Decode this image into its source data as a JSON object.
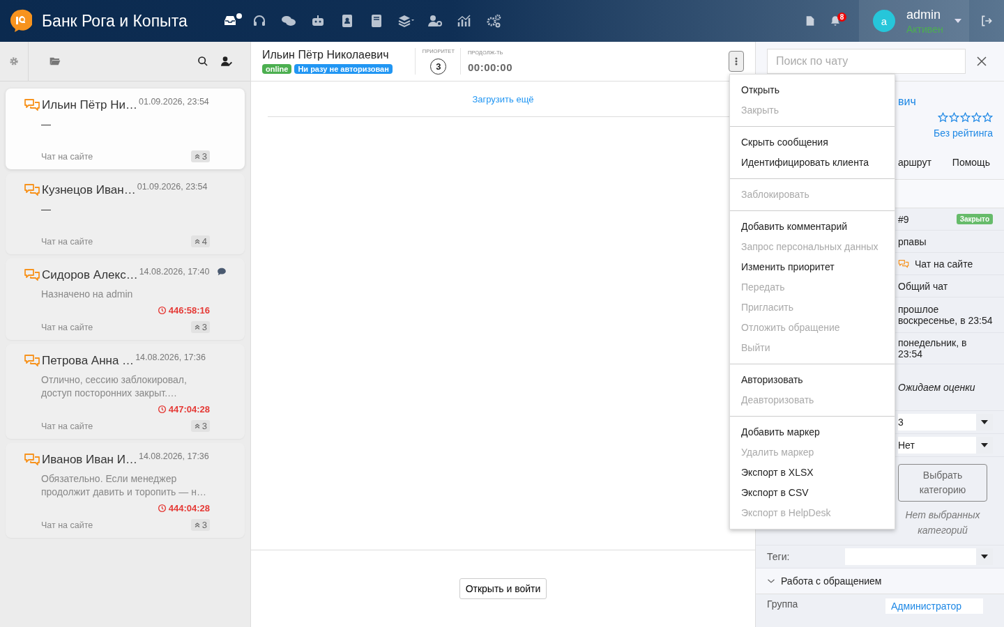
{
  "topbar": {
    "brand": "Банк Рога и Копыта",
    "nav": [
      {
        "dot": true
      },
      {
        "dot": false
      },
      {
        "dot": false
      },
      {
        "dot": false
      },
      {
        "dot": false
      },
      {
        "dot": false
      },
      {
        "dot": false
      },
      {
        "dot": false
      },
      {
        "dot": false
      },
      {
        "dot": false
      }
    ],
    "notifications": "8",
    "user": {
      "initial": "a",
      "name": "admin",
      "status": "Активен"
    }
  },
  "chat_list": [
    {
      "name": "Ильин Пётр Ни…",
      "date": "01.09.2026, 23:54",
      "preview": "—",
      "channel": "Чат на сайте",
      "priority": "3",
      "selected": true,
      "comment": false
    },
    {
      "name": "Кузнецов Иван…",
      "date": "01.09.2026, 23:54",
      "preview": "—",
      "channel": "Чат на сайте",
      "priority": "4",
      "selected": false,
      "comment": false
    },
    {
      "name": "Сидоров Алекс…",
      "date": "14.08.2026, 17:40",
      "preview": "Назначено на admin",
      "timer": "446:58:16",
      "channel": "Чат на сайте",
      "priority": "3",
      "selected": false,
      "comment": true
    },
    {
      "name": "Петрова Анна …",
      "date": "14.08.2026, 17:36",
      "preview": "Отлично, сессию заблокировал, доступ посторонних закрыт.…",
      "timer": "447:04:28",
      "channel": "Чат на сайте",
      "priority": "3",
      "selected": false,
      "comment": false
    },
    {
      "name": "Иванов Иван И…",
      "date": "14.08.2026, 17:36",
      "preview": "Обязательно. Если менеджер продолжит давить и торопить — н…",
      "timer": "444:04:28",
      "channel": "Чат на сайте",
      "priority": "3",
      "selected": false,
      "comment": false
    }
  ],
  "conversation": {
    "client_name": "Ильин Пётр Николаевич",
    "badges": [
      {
        "label": "online",
        "color": "#4caf50"
      },
      {
        "label": "Ни разу не авторизован",
        "color": "#2196f3"
      }
    ],
    "priority_label": "ПРИОРИТЕТ",
    "priority": "3",
    "duration_label": "ПРОДОЛЖ-ТЬ",
    "duration": "00:00:00",
    "load_more": "Загрузить ещё",
    "action": "Открыть и войти"
  },
  "menu": {
    "groups": [
      [
        {
          "label": "Открыть",
          "disabled": false
        },
        {
          "label": "Закрыть",
          "disabled": true
        }
      ],
      [
        {
          "label": "Скрыть сообщения",
          "disabled": false
        },
        {
          "label": "Идентифицировать клиента",
          "disabled": false
        }
      ],
      [
        {
          "label": "Заблокировать",
          "disabled": true
        }
      ],
      [
        {
          "label": "Добавить комментарий",
          "disabled": false
        },
        {
          "label": "Запрос персональных данных",
          "disabled": true
        },
        {
          "label": "Изменить приоритет",
          "disabled": false
        },
        {
          "label": "Передать",
          "disabled": true
        },
        {
          "label": "Пригласить",
          "disabled": true
        },
        {
          "label": "Отложить обращение",
          "disabled": true
        },
        {
          "label": "Выйти",
          "disabled": true
        }
      ],
      [
        {
          "label": "Авторизовать",
          "disabled": false
        },
        {
          "label": "Деавторизовать",
          "disabled": true
        }
      ],
      [
        {
          "label": "Добавить маркер",
          "disabled": false
        },
        {
          "label": "Удалить маркер",
          "disabled": true
        },
        {
          "label": "Экспорт в XLSX",
          "disabled": false
        },
        {
          "label": "Экспорт в CSV",
          "disabled": false
        },
        {
          "label": "Экспорт в HelpDesk",
          "disabled": true
        }
      ]
    ]
  },
  "info_panel": {
    "search": {
      "placeholder": "Поиск по чату"
    },
    "client": {
      "name": "вич",
      "stars": 0,
      "rating": "Без рейтинга"
    },
    "tabs": [
      {
        "label": "аршрут",
        "selected": false
      },
      {
        "label": "Помощь",
        "selected": false
      }
    ],
    "details": [
      {
        "kind": "status",
        "value": "#9",
        "badge": "Закрыто"
      },
      {
        "kind": "text",
        "value": "рпавы"
      },
      {
        "kind": "channel",
        "value": "Чат на сайте"
      },
      {
        "kind": "text",
        "value": "Общий чат"
      },
      {
        "kind": "text",
        "value": "прошлое воскресенье, в 23:54"
      },
      {
        "kind": "text",
        "value": "понедельник, в 23:54"
      },
      {
        "kind": "italic",
        "value": "Ожидаем оценки"
      },
      {
        "kind": "select",
        "value": "3"
      },
      {
        "kind": "select",
        "value": "Нет"
      },
      {
        "kind": "category",
        "button": "Выбрать категорию",
        "note": "Нет выбранных категорий"
      },
      {
        "kind": "labeled-select",
        "label": "Теги:"
      }
    ],
    "section": {
      "title": "Работа с обращением",
      "expanded": true
    },
    "group_row": {
      "label": "Группа",
      "value": "Администратор"
    }
  }
}
